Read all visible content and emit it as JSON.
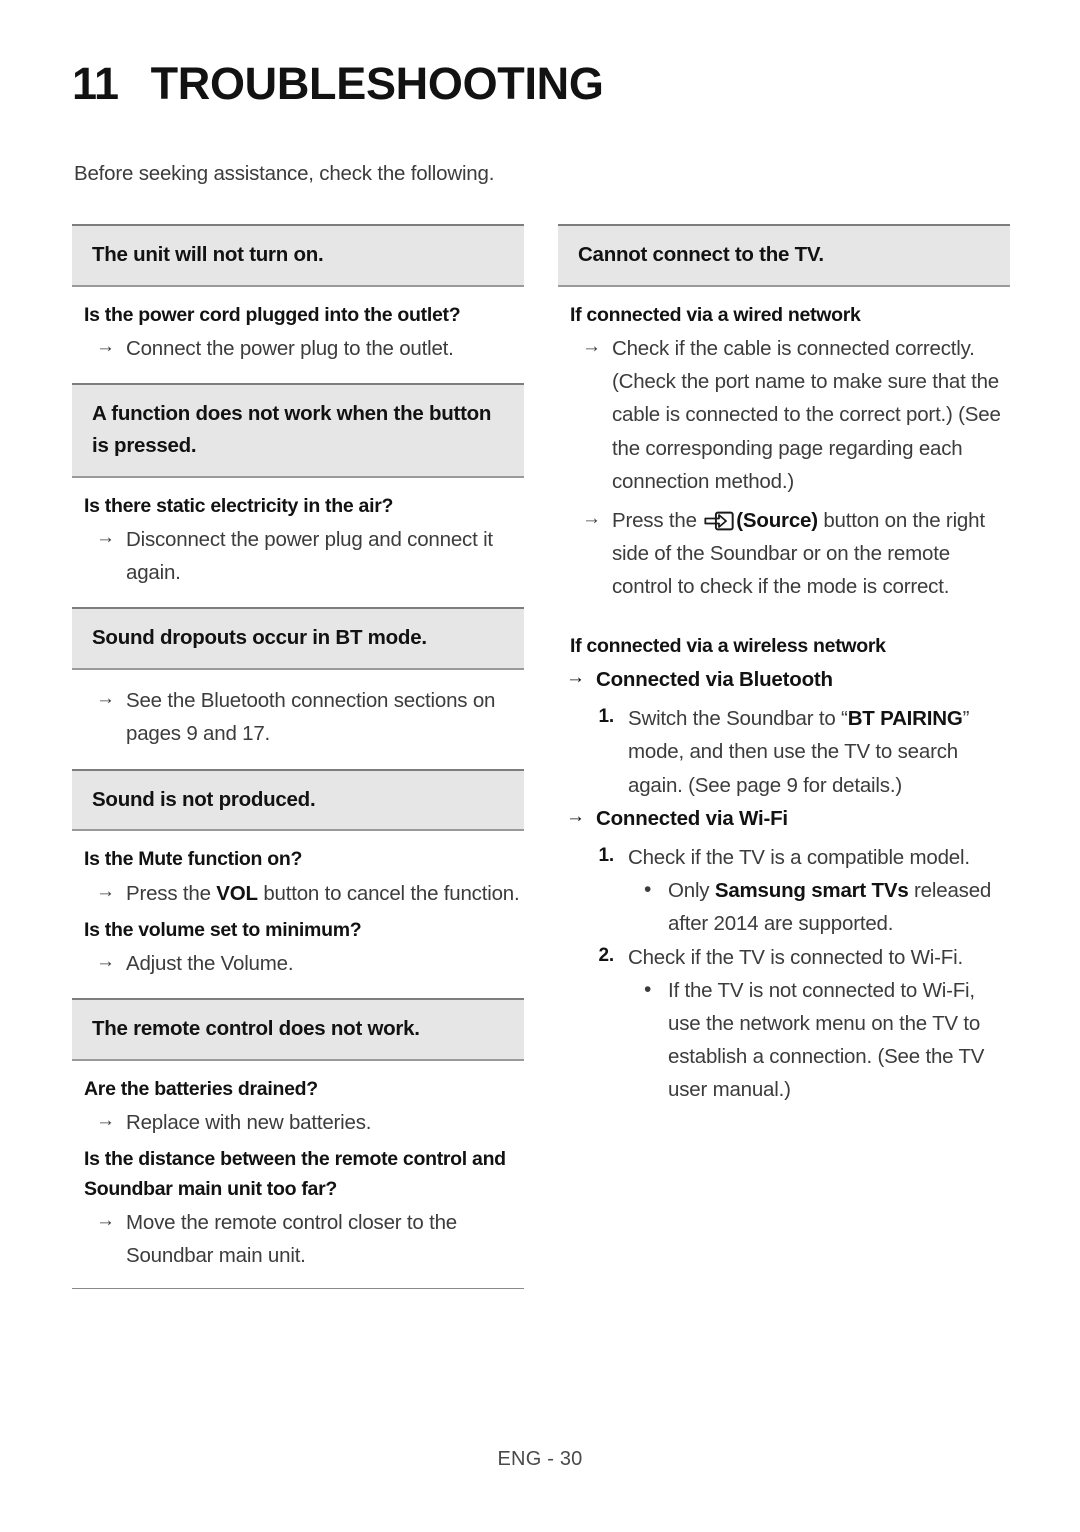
{
  "document": {
    "chapter_number": "11",
    "chapter_title": "TROUBLESHOOTING",
    "intro": "Before seeking assistance, check the following.",
    "footer": "ENG - 30"
  },
  "icons": {
    "arrow": "→",
    "bullet": "•",
    "source_icon_name": "source-input-icon"
  },
  "left_column": {
    "sections": [
      {
        "heading": "The unit will not turn on.",
        "items": [
          {
            "type": "question",
            "text": "Is the power cord plugged into the outlet?"
          },
          {
            "type": "answer",
            "text": "Connect the power plug to the outlet."
          }
        ]
      },
      {
        "heading": "A function does not work when the button is pressed.",
        "items": [
          {
            "type": "question",
            "text": "Is there static electricity in the air?"
          },
          {
            "type": "answer",
            "text": "Disconnect the power plug and connect it again."
          }
        ]
      },
      {
        "heading": "Sound dropouts occur in BT mode.",
        "items": [
          {
            "type": "answer",
            "text": "See the Bluetooth connection sections on pages 9 and 17."
          }
        ]
      },
      {
        "heading": "Sound is not produced.",
        "items": [
          {
            "type": "question",
            "text": "Is the Mute function on?"
          },
          {
            "type": "answer_rich",
            "pre": "Press the ",
            "bold": "VOL",
            "post": " button to cancel the function."
          },
          {
            "type": "question",
            "text": "Is the volume set to minimum?"
          },
          {
            "type": "answer",
            "text": "Adjust the Volume."
          }
        ]
      },
      {
        "heading": "The remote control does not work.",
        "items": [
          {
            "type": "question",
            "text": "Are the batteries drained?"
          },
          {
            "type": "answer",
            "text": "Replace with new batteries."
          },
          {
            "type": "question",
            "text": "Is the distance between the remote control and Soundbar main unit too far?"
          },
          {
            "type": "answer",
            "text": "Move the remote control closer to the Soundbar main unit."
          }
        ]
      }
    ]
  },
  "right_column": {
    "heading": "Cannot connect to the TV.",
    "wired": {
      "title": "If connected via a wired network",
      "answer_1": "Check if the cable is connected correctly. (Check the port name to make sure that the cable is connected to the correct port.) (See the corresponding page regarding each connection method.)",
      "answer_2_pre": "Press the ",
      "answer_2_bold": "(Source)",
      "answer_2_post": " button on the right side of the Soundbar or on the remote control to check if the mode is correct."
    },
    "wireless": {
      "title": "If connected via a wireless network",
      "bluetooth_label": "Connected via Bluetooth",
      "bluetooth_steps": [
        {
          "number": "1.",
          "pre": "Switch the Soundbar to “",
          "bold": "BT PAIRING",
          "post": "” mode, and then use the TV to search again. (See page 9 for details.)"
        }
      ],
      "wifi_label": "Connected via Wi-Fi",
      "wifi_steps": [
        {
          "number": "1.",
          "text": "Check if the TV is a compatible model.",
          "bullets": [
            {
              "pre": "Only ",
              "bold": "Samsung smart TVs",
              "post": " released after 2014 are supported."
            }
          ]
        },
        {
          "number": "2.",
          "text": "Check if the TV is connected to Wi-Fi.",
          "bullets": [
            {
              "pre": "If the TV is not connected to Wi-Fi, use the network menu on the TV to establish a connection. (See the TV user manual.)",
              "bold": "",
              "post": ""
            }
          ]
        }
      ]
    }
  }
}
